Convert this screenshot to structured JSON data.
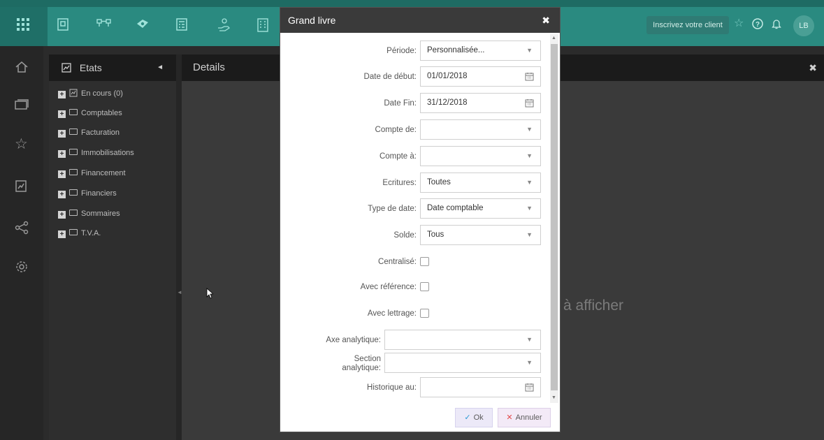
{
  "topbar": {
    "icons": [
      "apps-grid-icon",
      "ledger-icon",
      "org-chart-icon",
      "money-icon",
      "calculator-icon",
      "hand-money-icon",
      "building-icon"
    ],
    "client_button": "Inscrivez votre client",
    "avatar_initials": "LB",
    "accent": "#2a8a80"
  },
  "leftnav": {
    "icons": [
      "home-icon",
      "screens-icon",
      "star-icon",
      "report-icon",
      "share-icon",
      "settings-icon"
    ]
  },
  "etats": {
    "title": "Etats",
    "items": [
      {
        "label": "En cours (0)",
        "icon": "report-icon"
      },
      {
        "label": "Comptables",
        "icon": "folder-icon"
      },
      {
        "label": "Facturation",
        "icon": "folder-icon"
      },
      {
        "label": "Immobilisations",
        "icon": "folder-icon"
      },
      {
        "label": "Financement",
        "icon": "folder-icon"
      },
      {
        "label": "Financiers",
        "icon": "folder-icon"
      },
      {
        "label": "Sommaires",
        "icon": "folder-icon"
      },
      {
        "label": "T.V.A.",
        "icon": "folder-icon"
      }
    ]
  },
  "details": {
    "title": "Details",
    "empty_message": "à afficher"
  },
  "dialog": {
    "title": "Grand livre",
    "fields": {
      "periode": {
        "label": "Période:",
        "value": "Personnalisée..."
      },
      "date_debut": {
        "label": "Date de début:",
        "value": "01/01/2018"
      },
      "date_fin": {
        "label": "Date Fin:",
        "value": "31/12/2018"
      },
      "compte_de": {
        "label": "Compte de:",
        "value": ""
      },
      "compte_a": {
        "label": "Compte à:",
        "value": ""
      },
      "ecritures": {
        "label": "Ecritures:",
        "value": "Toutes"
      },
      "type_date": {
        "label": "Type de date:",
        "value": "Date comptable"
      },
      "solde": {
        "label": "Solde:",
        "value": "Tous"
      },
      "centralise": {
        "label": "Centralisé:",
        "checked": false
      },
      "avec_reference": {
        "label": "Avec référence:",
        "checked": false
      },
      "avec_lettrage": {
        "label": "Avec lettrage:",
        "checked": false
      },
      "axe_analytique": {
        "label": "Axe analytique:",
        "value": ""
      },
      "section_analytique": {
        "label_line1": "Section",
        "label_line2": "analytique:",
        "value": ""
      },
      "historique": {
        "label": "Historique au:",
        "value": ""
      }
    },
    "ok_label": "Ok",
    "cancel_label": "Annuler"
  }
}
